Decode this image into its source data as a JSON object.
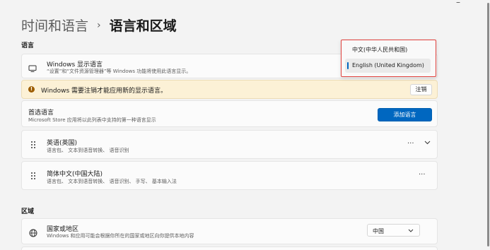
{
  "breadcrumb": {
    "parent": "时间和语言",
    "separator": "›",
    "current": "语言和区域"
  },
  "language_section": {
    "label": "语言",
    "display_language": {
      "icon": "monitor-icon",
      "title": "Windows 显示语言",
      "subtitle": "“设置”和“文件资源管理器”等 Windows 功能将使用此语言显示。"
    },
    "warning": {
      "icon": "warning-icon",
      "text": "Windows 需要注销才能应用新的显示语言。",
      "button": "注销"
    },
    "preferred": {
      "title": "首选语言",
      "subtitle": "Microsoft Store 应用将以此列表中支持的第一种语言显示",
      "button": "添加语言"
    },
    "languages": [
      {
        "name": "英语(英国)",
        "features": "语言包、 文本到语音转换、 语音识别",
        "more": "···",
        "expand": "⌄"
      },
      {
        "name": "简体中文(中国大陆)",
        "features": "语言包、 文本到语音转换、 语音识别、 手写、 基本输入法",
        "more": "···"
      }
    ]
  },
  "region_section": {
    "label": "区域",
    "country": {
      "icon": "globe-icon",
      "title": "国家或地区",
      "subtitle": "Windows 和应用可能会根据你所在的国家或地区向你提供本地内容",
      "value": "中国"
    }
  },
  "flyout": {
    "options": [
      "中文(中华人民共和国)",
      "English (United Kingdom)"
    ],
    "selected_index": 1,
    "highlight_color": "#e0413d"
  },
  "window": {
    "minimize": "–"
  },
  "colors": {
    "accent": "#0067c0",
    "warning_bg": "#fcf1d6",
    "warning_icon": "#9d5d00"
  }
}
